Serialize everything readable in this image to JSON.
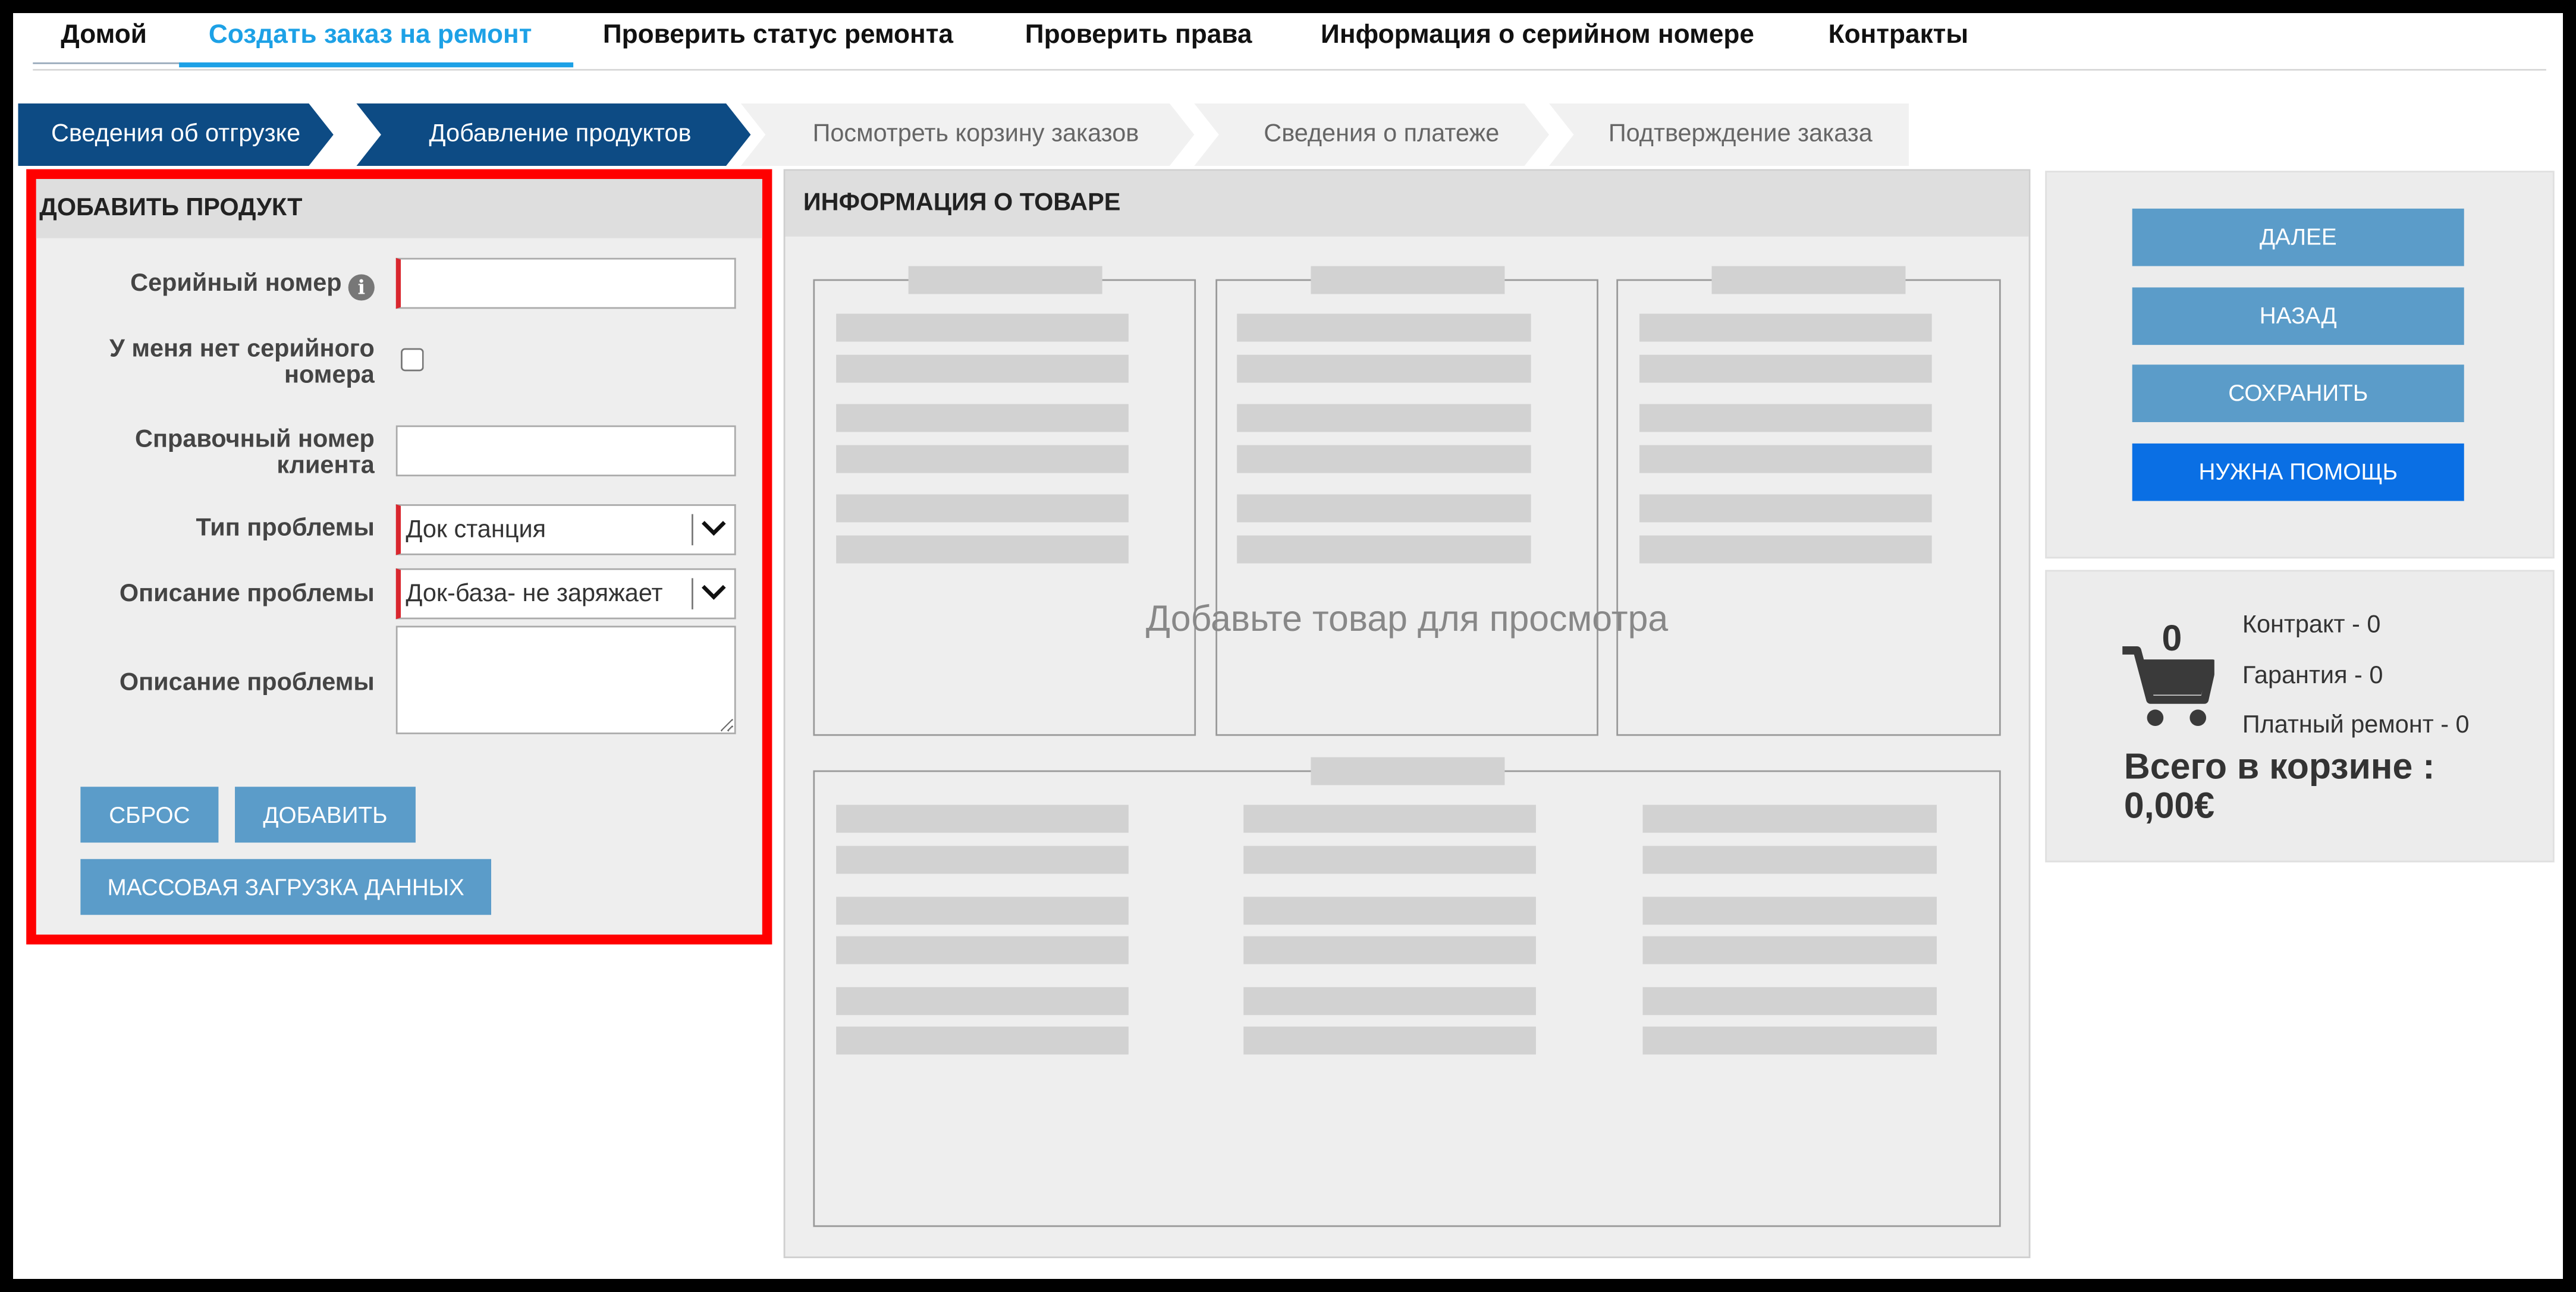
{
  "nav": {
    "items": [
      {
        "label": "Домой"
      },
      {
        "label": "Создать заказ на ремонт"
      },
      {
        "label": "Проверить статус ремонта"
      },
      {
        "label": "Проверить права"
      },
      {
        "label": "Информация о серийном номере"
      },
      {
        "label": "Контракты"
      }
    ],
    "active_index": 1
  },
  "steps": [
    {
      "label": "Сведения об отгрузке",
      "state": "done"
    },
    {
      "label": "Добавление продуктов",
      "state": "current"
    },
    {
      "label": "Посмотреть корзину заказов",
      "state": "todo"
    },
    {
      "label": "Сведения о платеже",
      "state": "todo"
    },
    {
      "label": "Подтверждение заказа",
      "state": "todo"
    }
  ],
  "add_product": {
    "title": "ДОБАВИТЬ ПРОДУКТ",
    "serial_label": "Серийный номер",
    "serial_value": "",
    "info_icon": "info-icon",
    "no_serial_label_line1": "У меня нет серийного",
    "no_serial_label_line2": "номера",
    "no_serial_checked": false,
    "customer_ref_label_line1": "Справочный номер",
    "customer_ref_label_line2": "клиента",
    "customer_ref_value": "",
    "problem_type_label": "Тип проблемы",
    "problem_type_value": "Док станция",
    "problem_desc_label": "Описание проблемы",
    "problem_desc_value": "Док-база- не заряжает",
    "problem_text_label": "Описание проблемы",
    "problem_text_value": "",
    "reset_label": "СБРОС",
    "add_label": "ДОБАВИТЬ",
    "bulk_label": "МАССОВАЯ ЗАГРУЗКА ДАННЫХ"
  },
  "product_info": {
    "title": "ИНФОРМАЦИЯ О ТОВАРЕ",
    "empty_message": "Добавьте товар для просмотра"
  },
  "actions": {
    "next_label": "ДАЛЕЕ",
    "back_label": "НАЗАД",
    "save_label": "СОХРАНИТЬ",
    "help_label": "НУЖНА ПОМОЩЬ"
  },
  "cart": {
    "count": "0",
    "icon": "cart-icon",
    "contract": "Контракт - 0",
    "warranty": "Гарантия - 0",
    "paid_repair": "Платный ремонт - 0",
    "total_line1": "Всего в корзине :",
    "total_line2": "0,00€"
  },
  "colors": {
    "accent": "#1da1e6",
    "step_active": "#0d4b84",
    "button": "#5b9cc9",
    "help_button": "#0a6fe4",
    "highlight_border": "#ff0000",
    "required_marker": "#d9262e"
  }
}
